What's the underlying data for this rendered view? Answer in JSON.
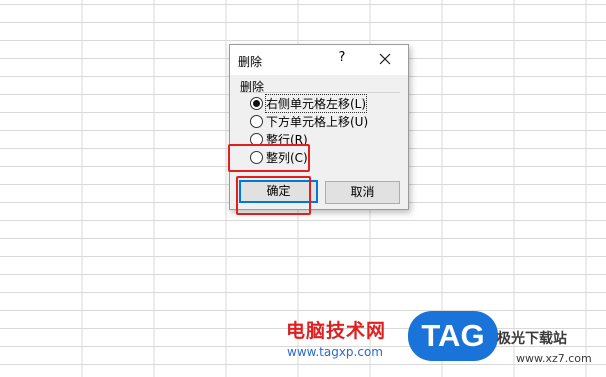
{
  "dialog": {
    "title": "删除",
    "help_label": "?",
    "group_label": "删除",
    "options": [
      {
        "label": "右侧单元格左移(L)",
        "checked": true
      },
      {
        "label": "下方单元格上移(U)",
        "checked": false
      },
      {
        "label": "整行(R)",
        "checked": false
      },
      {
        "label": "整列(C)",
        "checked": false
      }
    ],
    "ok_label": "确定",
    "cancel_label": "取消"
  },
  "watermark": {
    "site_name": "电脑技术网",
    "site_url": "www.tagxp.com",
    "logo_text": "TAG",
    "partner_name": "极光下载站",
    "partner_url": "www.xz7.com"
  },
  "colors": {
    "highlight": "#e02020",
    "focus_blue": "#0078d7",
    "logo_blue": "#1a73d9"
  }
}
